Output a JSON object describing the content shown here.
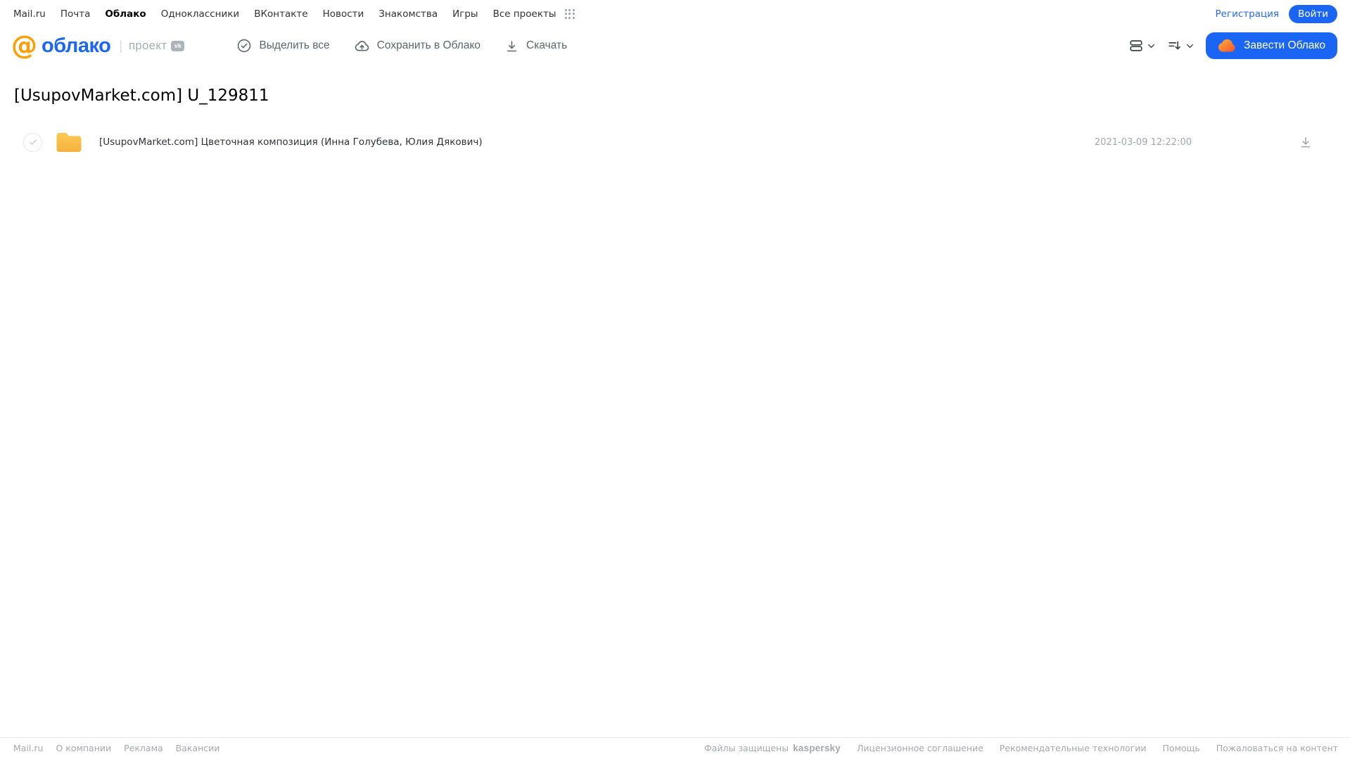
{
  "topnav": {
    "items": [
      {
        "label": "Mail.ru"
      },
      {
        "label": "Почта"
      },
      {
        "label": "Облако",
        "active": true
      },
      {
        "label": "Одноклассники"
      },
      {
        "label": "ВКонтакте"
      },
      {
        "label": "Новости"
      },
      {
        "label": "Знакомства"
      },
      {
        "label": "Игры"
      },
      {
        "label": "Все проекты"
      }
    ],
    "registration_label": "Регистрация",
    "login_label": "Войти"
  },
  "header": {
    "logo_at": "@",
    "logo_text": "облако",
    "project_label": "проект",
    "vk_badge": "vk",
    "toolbar": {
      "select_all": "Выделить все",
      "save_to_cloud": "Сохранить в Облако",
      "download": "Скачать"
    },
    "get_cloud_label": "Завести Облако"
  },
  "content": {
    "title": "[UsupovMarket.com] U_129811",
    "files": [
      {
        "type": "folder",
        "name": "[UsupovMarket.com] Цветочная композиция (Инна Голубева, Юлия Дякович)",
        "date": "2021-03-09 12:22:00"
      }
    ]
  },
  "footer": {
    "left_links": [
      "Mail.ru",
      "О компании",
      "Реклама",
      "Вакансии"
    ],
    "protected_text": "Файлы защищены",
    "kaspersky_label": "kaspersky",
    "right_links": [
      "Лицензионное соглашение",
      "Рекомендательные технологии",
      "Помощь",
      "Пожаловаться на контент"
    ]
  },
  "colors": {
    "accent_blue": "#1B65F5",
    "logo_orange": "#FF9E00",
    "folder_yellow": "#F9BE4B",
    "kaspersky_teal": "#00A88E",
    "muted_gray": "#A5A8AD"
  }
}
